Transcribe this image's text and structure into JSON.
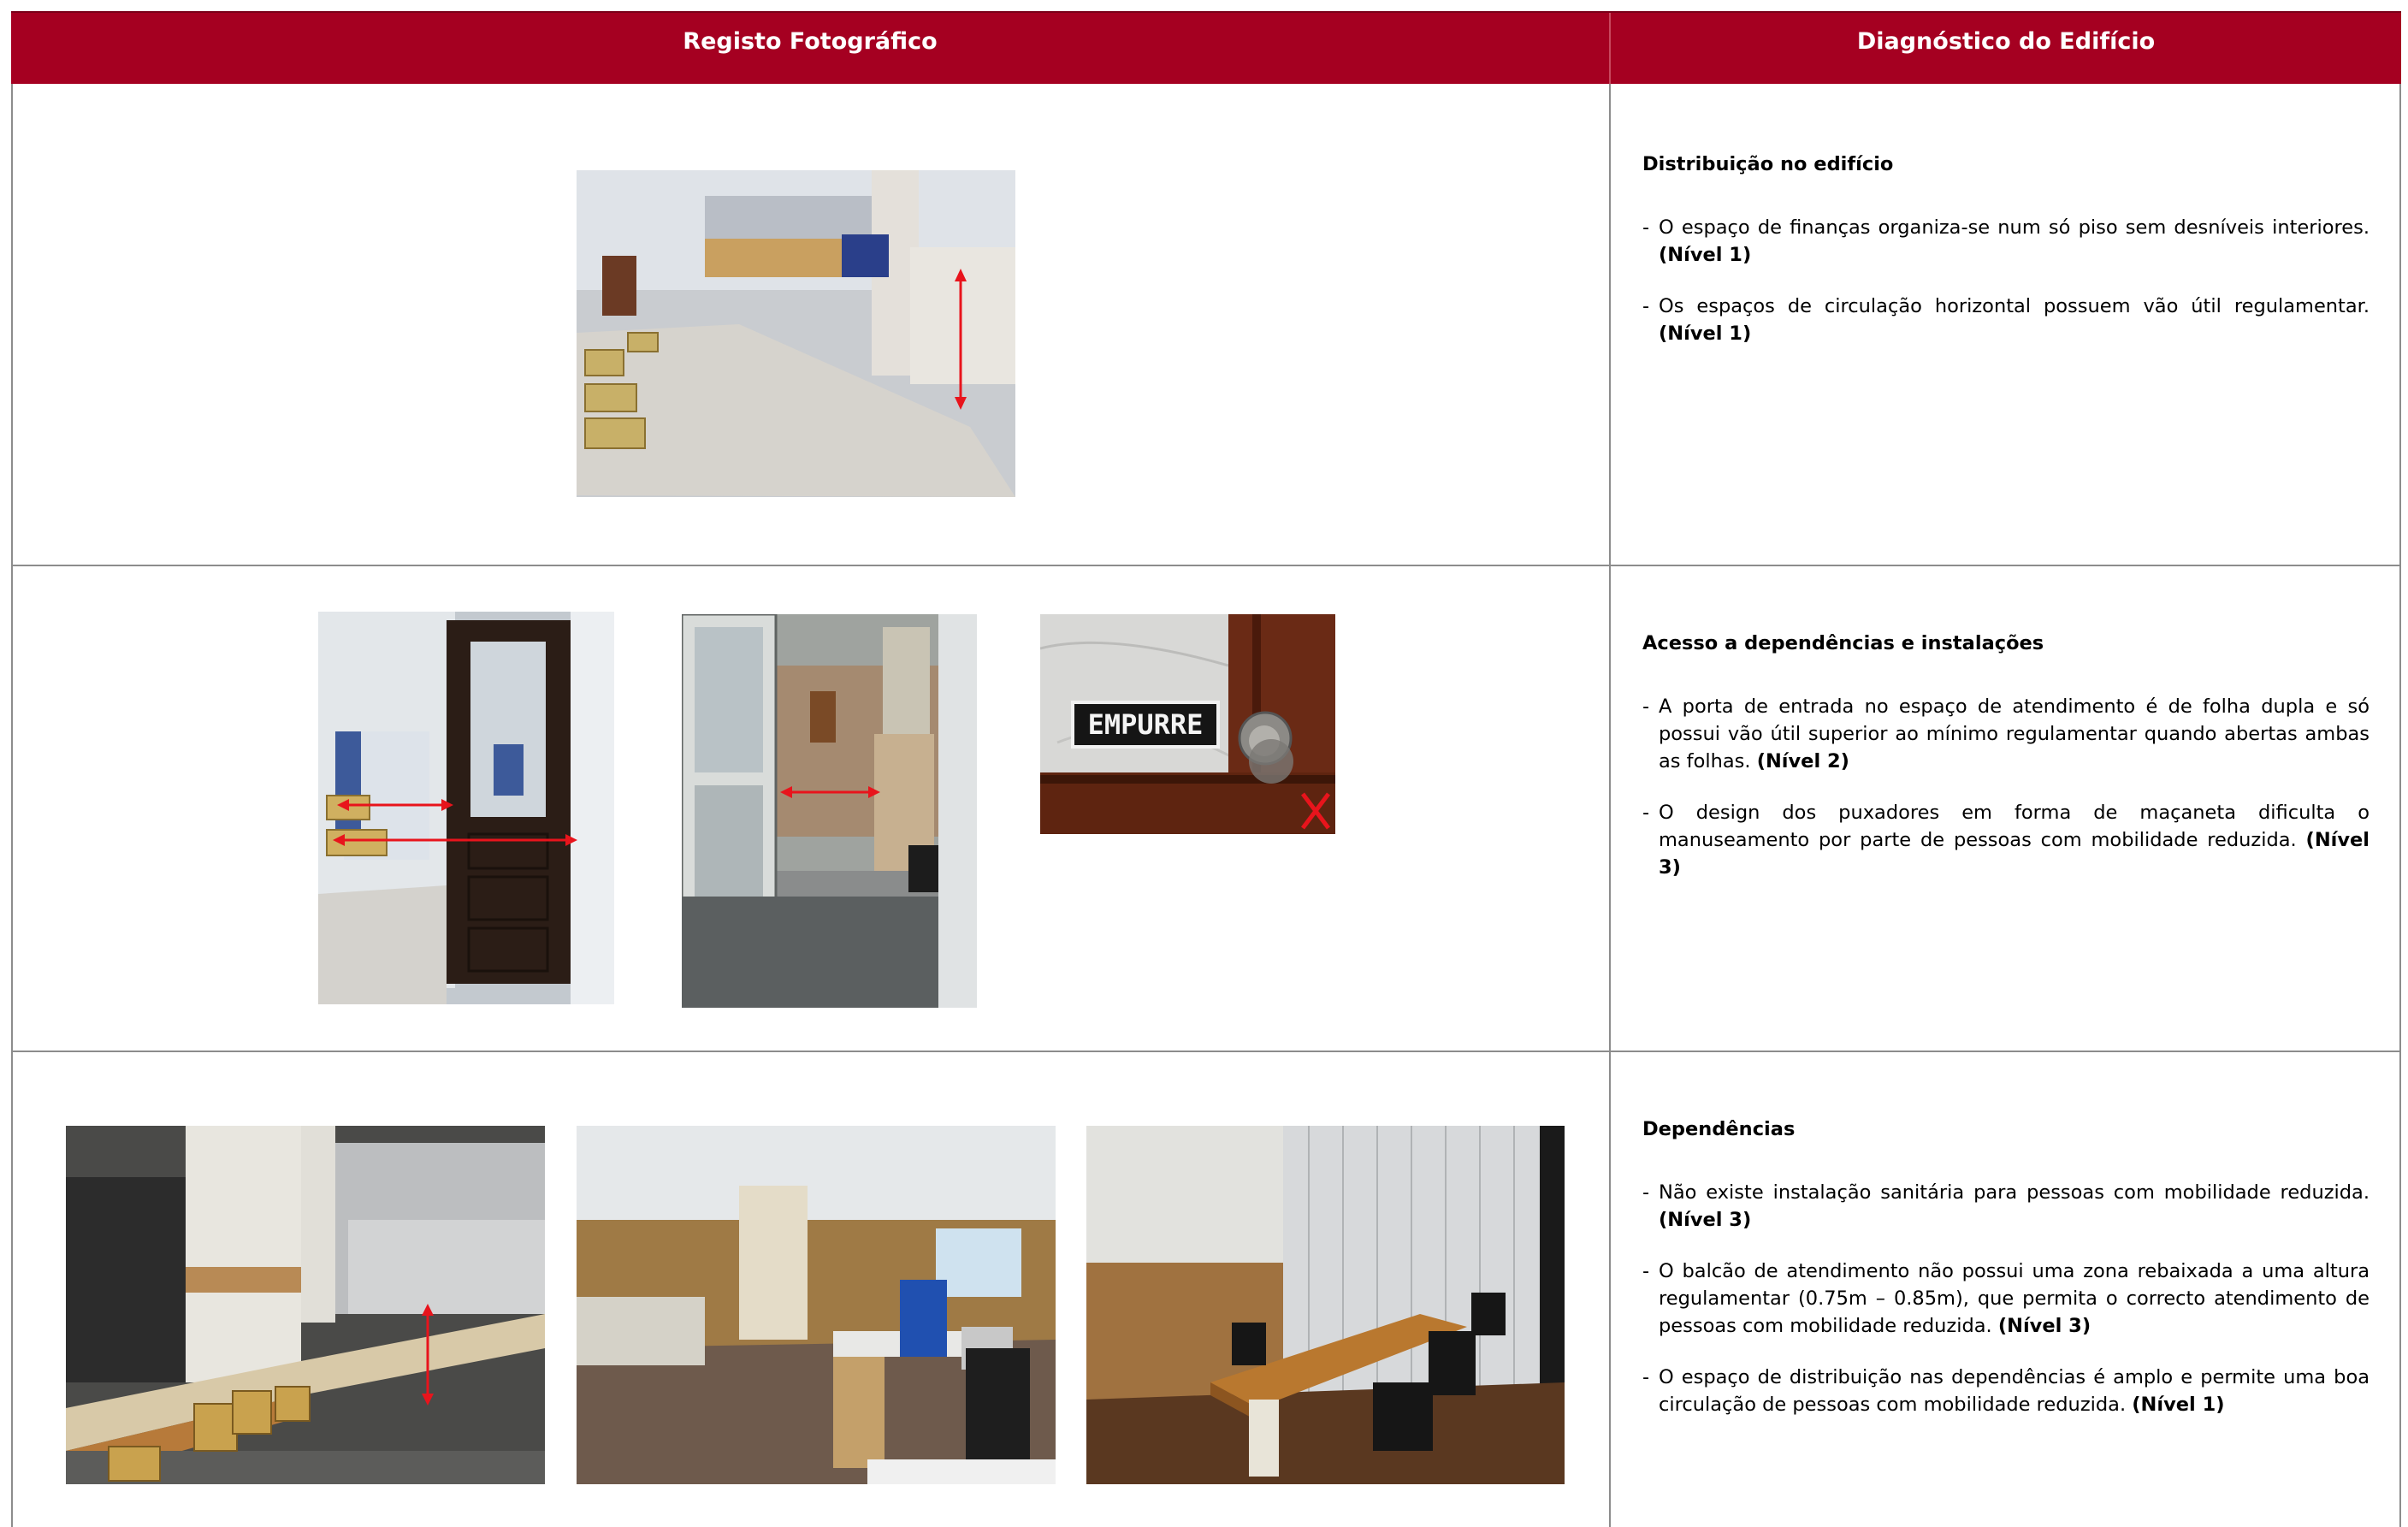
{
  "header": {
    "left_title": "Registo Fotográfico",
    "right_title": "Diagnóstico do Edifício"
  },
  "sections": [
    {
      "title": "Distribuição no edifício",
      "items": [
        {
          "text": "O espaço de finanças organiza-se num só piso sem desníveis interiores.",
          "level": "(Nível 1)"
        },
        {
          "text": "Os espaços de circulação horizontal possuem vão útil regulamentar.",
          "level": "(Nível 1)"
        }
      ]
    },
    {
      "title": "Acesso a dependências e instalações",
      "items": [
        {
          "text": "A porta de entrada no espaço de atendimento é de folha dupla e só possui vão útil superior ao mínimo regulamentar quando abertas ambas as folhas.",
          "level": "(Nível 2)"
        },
        {
          "text": "O design dos puxadores em forma de maçaneta dificulta o manuseamento por parte de pessoas com mobilidade reduzida.",
          "level": "(Nível 3)"
        }
      ]
    },
    {
      "title": "Dependências",
      "items": [
        {
          "text": "Não existe instalação sanitária para pessoas com mobilidade reduzida.",
          "level": "(Nível 3)"
        },
        {
          "text": "O balcão de atendimento não possui uma zona rebaixada a uma altura regulamentar (0.75m – 0.85m), que permita o correcto atendimento de pessoas com mobilidade reduzida.",
          "level": "(Nível 3)"
        },
        {
          "text": "O espaço de distribuição nas dependências é amplo e permite uma boa circulação de pessoas com mobilidade reduzida.",
          "level": "(Nível 1)"
        }
      ]
    }
  ],
  "photos": {
    "sign_text": "EMPURRE"
  },
  "colors": {
    "header_bg": "#a50021",
    "arrow": "#e8141c"
  }
}
